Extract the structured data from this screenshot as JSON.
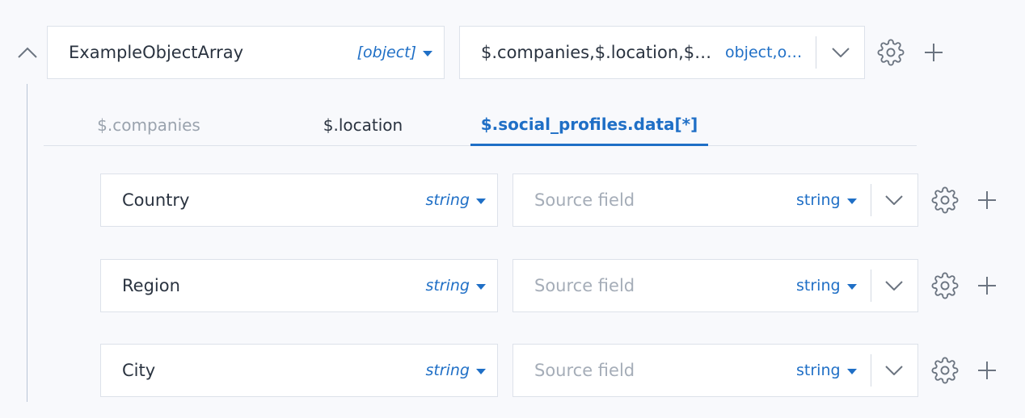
{
  "root": {
    "name": "ExampleObjectArray",
    "type": "[object]",
    "source_path": "$.companies,$.location,$…",
    "source_type": "object,o…"
  },
  "tabs": [
    {
      "label": "$.companies"
    },
    {
      "label": "$.location"
    },
    {
      "label": "$.social_profiles.data[*]"
    }
  ],
  "active_tab": "$.social_profiles.data[*]",
  "fields": [
    {
      "name": "Country",
      "type": "string",
      "source_placeholder": "Source field",
      "source_type": "string"
    },
    {
      "name": "Region",
      "type": "string",
      "source_placeholder": "Source field",
      "source_type": "string"
    },
    {
      "name": "City",
      "type": "string",
      "source_placeholder": "Source field",
      "source_type": "string"
    }
  ],
  "colors": {
    "accent": "#1f6fc6",
    "muted": "#9aa3ae",
    "border": "#dde2ea",
    "icon": "#6b7480"
  },
  "icons": {
    "collapse": "chevron-up-icon",
    "expand": "chevron-down-icon",
    "settings": "gear-icon",
    "add": "plus-icon",
    "type": "caret-down-icon"
  }
}
